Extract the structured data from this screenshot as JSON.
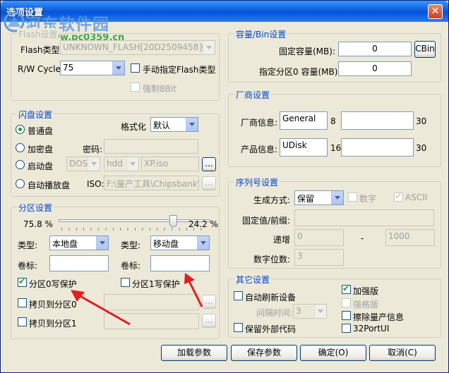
{
  "window": {
    "title": "选项设置",
    "close_glyph": "✕"
  },
  "watermark": {
    "text": "河东软件园",
    "url": "www.pc0359.cn"
  },
  "left": {
    "flash_group": {
      "legend": "Flash设置",
      "flash_type_label": "Flash类型:",
      "flash_type_value": "UNKNOWN_FLASH[20D2509458}",
      "rw_cycle_label": "R/W Cycle:",
      "rw_cycle_value": "75",
      "manual_flash_label": "手动指定Flash类型",
      "force_8bit_label": "强制8Bit"
    },
    "udisk_group": {
      "legend": "闪盘设置",
      "normal_label": "普通盘",
      "encrypted_label": "加密盘",
      "boot_label": "启动盘",
      "autoplay_label": "自动播放盘",
      "format_label": "格式化",
      "format_value": "默认",
      "password_label": "密码:",
      "dos_value": "DOS",
      "hdd_value": "hdd",
      "xp_value": "XP.iso",
      "iso_label": "ISO:",
      "iso_value": "F:\\量产工具\\Chipsbank\\C",
      "browse_label": "..."
    },
    "partition_group": {
      "legend": "分区设置",
      "left_percent": "75.8 %",
      "right_percent": "24.2 %",
      "slider_fraction": 0.758,
      "type_label1": "类型:",
      "type_value1": "本地盘",
      "type_label2": "类型:",
      "type_value2": "移动盘",
      "volume_label1": "卷标:",
      "volume_label2": "卷标:",
      "volume_value1": "",
      "volume_value2": "",
      "wp0_label": "分区0写保护",
      "wp1_label": "分区1写保护",
      "copy0_label": "拷贝到分区0",
      "copy1_label": "拷贝到分区1",
      "browse_label": "..."
    }
  },
  "right": {
    "capacity_group": {
      "legend": "容量/Bin设置",
      "fixed_label": "固定容量(MB):",
      "fixed_value": "0",
      "cbin_label": "CBin",
      "part0_label": "指定分区0 容量(MB):",
      "part0_value": "0"
    },
    "vendor_group": {
      "legend": "厂商设置",
      "vendor_label": "厂商信息:",
      "vendor_value": "General",
      "vendor_len": "8",
      "vendor_extra": "",
      "vendor_max": "30",
      "product_label": "产品信息:",
      "product_value": "UDisk",
      "product_len": "16",
      "product_extra": "",
      "product_max": "30"
    },
    "serial_group": {
      "legend": "序列号设置",
      "mode_label": "生成方式:",
      "mode_value": "保留",
      "digits_label": "数字",
      "ascii_label": "ASCII",
      "fixed_prefix_label": "固定值/前缀:",
      "fixed_prefix_value": "",
      "inc_label": "递增",
      "inc_start": "0",
      "dash": "-",
      "inc_end": "1000",
      "digit_count_label": "数字位数:",
      "digit_count_value": "3"
    },
    "other_group": {
      "legend": "其它设置",
      "auto_refresh_label": "自动刷新设备",
      "interval_label": "间隔时间:",
      "interval_value": "3",
      "keep_external_label": "保留外部代码",
      "enhanced_label": "加强版",
      "strong_label": "强格版",
      "erase_label": "擦除量产信息",
      "port32_label": "32PortUI"
    }
  },
  "buttons": {
    "load": "加载参数",
    "save": "保存参数",
    "ok": "确定(O)",
    "cancel": "取消(C)"
  },
  "colors": {
    "legend": "#0046d5",
    "title_bar": "#0a5fe0",
    "arrow_red": "#e02020",
    "check_green": "#21a121"
  }
}
